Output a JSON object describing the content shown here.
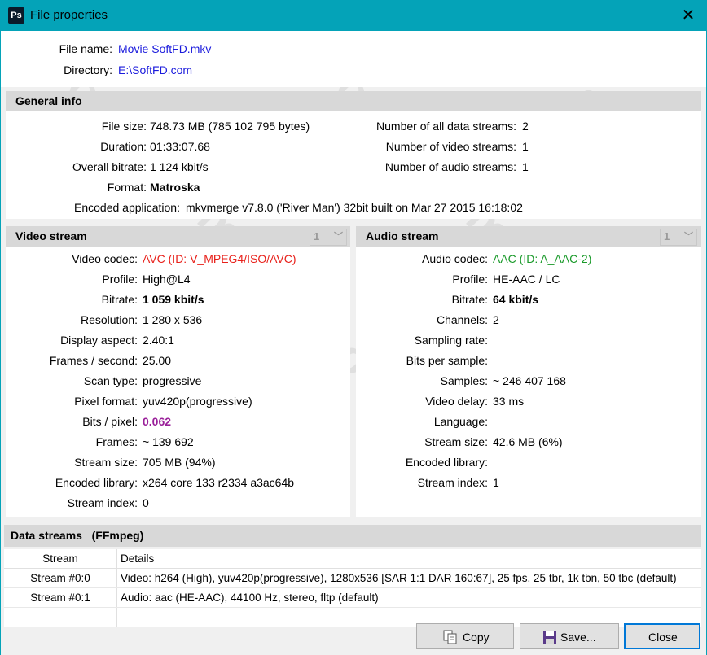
{
  "window": {
    "title": "File properties",
    "app_icon": "Ps",
    "close_glyph": "✕"
  },
  "file": {
    "name_label": "File name:",
    "name_value": "Movie SoftFD.mkv",
    "dir_label": "Directory:",
    "dir_value": "E:\\SoftFD.com"
  },
  "general": {
    "header": "General info",
    "left": [
      {
        "label": "File size:",
        "value": "748.73 MB (785 102 795 bytes)"
      },
      {
        "label": "Duration:",
        "value": "01:33:07.68"
      },
      {
        "label": "Overall bitrate:",
        "value": "1 124 kbit/s"
      },
      {
        "label": "Format:",
        "value": "Matroska"
      }
    ],
    "right": [
      {
        "label": "Number of all data streams:",
        "value": "2"
      },
      {
        "label": "Number of video streams:",
        "value": "1"
      },
      {
        "label": "Number of audio streams:",
        "value": "1"
      }
    ],
    "encoded_label": "Encoded application:",
    "encoded_value": "mkvmerge v7.8.0 ('River Man') 32bit built on Mar 27 2015 16:18:02"
  },
  "video": {
    "header": "Video stream",
    "selector": "1",
    "rows": [
      {
        "label": "Video codec:",
        "value": "AVC (ID: V_MPEG4/ISO/AVC)"
      },
      {
        "label": "Profile:",
        "value": "High@L4"
      },
      {
        "label": "Bitrate:",
        "value": "1 059 kbit/s"
      },
      {
        "label": "Resolution:",
        "value": "1 280 x 536"
      },
      {
        "label": "Display aspect:",
        "value": "2.40:1"
      },
      {
        "label": "Frames / second:",
        "value": "25.00"
      },
      {
        "label": "Scan type:",
        "value": "progressive"
      },
      {
        "label": "Pixel format:",
        "value": "yuv420p(progressive)"
      },
      {
        "label": "Bits / pixel:",
        "value": "0.062"
      },
      {
        "label": "Frames:",
        "value": "~ 139 692"
      },
      {
        "label": "Stream size:",
        "value": "705 MB (94%)"
      },
      {
        "label": "Encoded library:",
        "value": "x264 core 133 r2334 a3ac64b"
      },
      {
        "label": "Stream index:",
        "value": "0"
      }
    ]
  },
  "audio": {
    "header": "Audio stream",
    "selector": "1",
    "rows": [
      {
        "label": "Audio codec:",
        "value": "AAC (ID: A_AAC-2)"
      },
      {
        "label": "Profile:",
        "value": "HE-AAC / LC"
      },
      {
        "label": "Bitrate:",
        "value": "64 kbit/s"
      },
      {
        "label": "Channels:",
        "value": "2"
      },
      {
        "label": "Sampling rate:",
        "value": ""
      },
      {
        "label": "Bits per sample:",
        "value": ""
      },
      {
        "label": "Samples:",
        "value": "~ 246 407 168"
      },
      {
        "label": "Video delay:",
        "value": "33 ms"
      },
      {
        "label": "Language:",
        "value": ""
      },
      {
        "label": "Stream size:",
        "value": "42.6 MB (6%)"
      },
      {
        "label": "Encoded library:",
        "value": ""
      },
      {
        "label": "Stream index:",
        "value": "1"
      }
    ]
  },
  "data_streams": {
    "header": "Data streams   (FFmpeg)",
    "columns": [
      "Stream",
      "Details"
    ],
    "rows": [
      {
        "stream": "Stream #0:0",
        "details": "Video: h264 (High), yuv420p(progressive), 1280x536 [SAR 1:1 DAR 160:67], 25 fps, 25 tbr, 1k tbn, 50 tbc (default)"
      },
      {
        "stream": "Stream #0:1",
        "details": "Audio: aac (HE-AAC), 44100 Hz, stereo, fltp (default)"
      }
    ]
  },
  "buttons": {
    "copy": "Copy",
    "save": "Save...",
    "close": "Close"
  },
  "colors": {
    "titlebar": "#04a3b8",
    "link": "#1a1adc",
    "video_codec": "#e8201a",
    "audio_codec": "#1a9a2a",
    "bits_pixel": "#9a209a"
  }
}
